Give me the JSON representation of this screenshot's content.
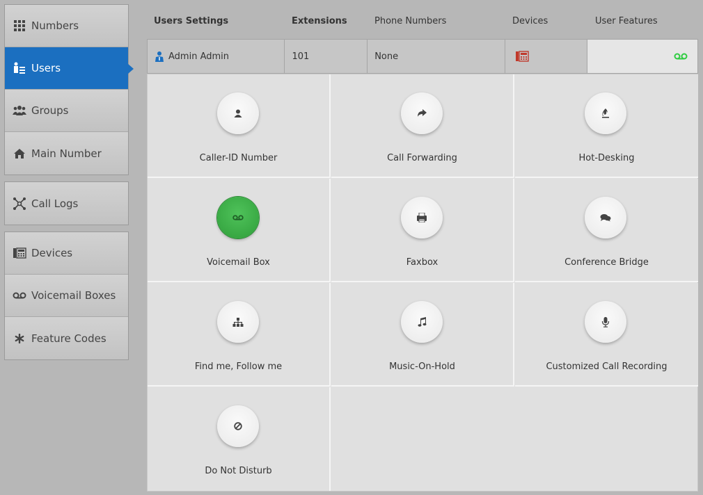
{
  "sidebar": {
    "group1": [
      {
        "label": "Numbers",
        "icon": "grid-icon"
      },
      {
        "label": "Users",
        "icon": "users-icon",
        "active": true
      },
      {
        "label": "Groups",
        "icon": "groups-icon"
      },
      {
        "label": "Main Number",
        "icon": "home-icon"
      }
    ],
    "group2": [
      {
        "label": "Call Logs",
        "icon": "network-icon"
      }
    ],
    "group3": [
      {
        "label": "Devices",
        "icon": "fax-phone-icon"
      },
      {
        "label": "Voicemail Boxes",
        "icon": "voicemail-icon"
      },
      {
        "label": "Feature Codes",
        "icon": "asterisk-icon"
      }
    ]
  },
  "header": {
    "users_settings": "Users Settings",
    "extensions": "Extensions",
    "phone_numbers": "Phone Numbers",
    "devices": "Devices",
    "user_features": "User Features"
  },
  "user_row": {
    "name": "Admin Admin",
    "extension": "101",
    "phone_numbers": "None"
  },
  "features": [
    {
      "label": "Caller-ID Number",
      "icon": "user-icon"
    },
    {
      "label": "Call Forwarding",
      "icon": "forward-icon"
    },
    {
      "label": "Hot-Desking",
      "icon": "fire-icon"
    },
    {
      "label": "Voicemail Box",
      "icon": "voicemail-icon",
      "active": true
    },
    {
      "label": "Faxbox",
      "icon": "fax-icon"
    },
    {
      "label": "Conference Bridge",
      "icon": "chat-icon"
    },
    {
      "label": "Find me, Follow me",
      "icon": "sitemap-icon"
    },
    {
      "label": "Music-On-Hold",
      "icon": "music-icon"
    },
    {
      "label": "Customized Call Recording",
      "icon": "microphone-icon"
    },
    {
      "label": "Do Not Disturb",
      "icon": "ban-icon"
    }
  ],
  "colors": {
    "active_nav": "#1b6fc0",
    "active_feature": "#3aa845",
    "devices_icon": "#c0392b",
    "voicemail_indicator": "#2ecc40"
  }
}
